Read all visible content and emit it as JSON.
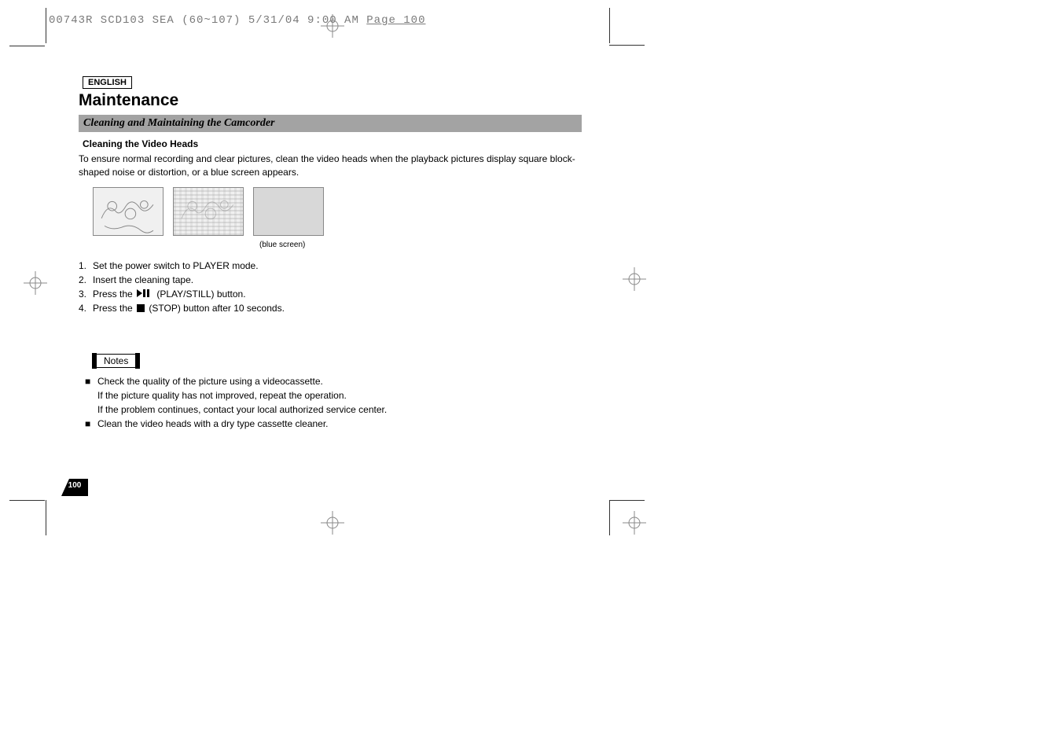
{
  "doc_header": {
    "prefix": "00743R SCD103 SEA (60~107)  5/31/04 9:00 AM  ",
    "page_part": "Page 100"
  },
  "language_label": "ENGLISH",
  "title": "Maintenance",
  "section_heading": "Cleaning and Maintaining the Camcorder",
  "subheading": "Cleaning the Video Heads",
  "intro": "To ensure normal recording and clear pictures, clean the video heads when the playback pictures display square block-shaped noise or distortion, or a blue screen appears.",
  "blue_screen_caption": "(blue screen)",
  "steps": [
    {
      "n": "1.",
      "text": "Set the power switch to PLAYER mode."
    },
    {
      "n": "2.",
      "text": "Insert the cleaning tape."
    },
    {
      "n": "3.",
      "text_before": "Press the ",
      "icon": "play-pause",
      "text_after": "(PLAY/STILL) button."
    },
    {
      "n": "4.",
      "text_before": "Press the ",
      "icon": "stop",
      "text_after": "(STOP) button after 10 seconds."
    }
  ],
  "notes_label": "Notes",
  "notes": [
    {
      "lines": [
        "Check the quality of the picture using a videocassette.",
        "If the picture quality has not improved, repeat the operation.",
        "If the problem continues, contact your local authorized service center."
      ]
    },
    {
      "lines": [
        "Clean the video heads with a dry type cassette cleaner."
      ]
    }
  ],
  "page_number": "100"
}
